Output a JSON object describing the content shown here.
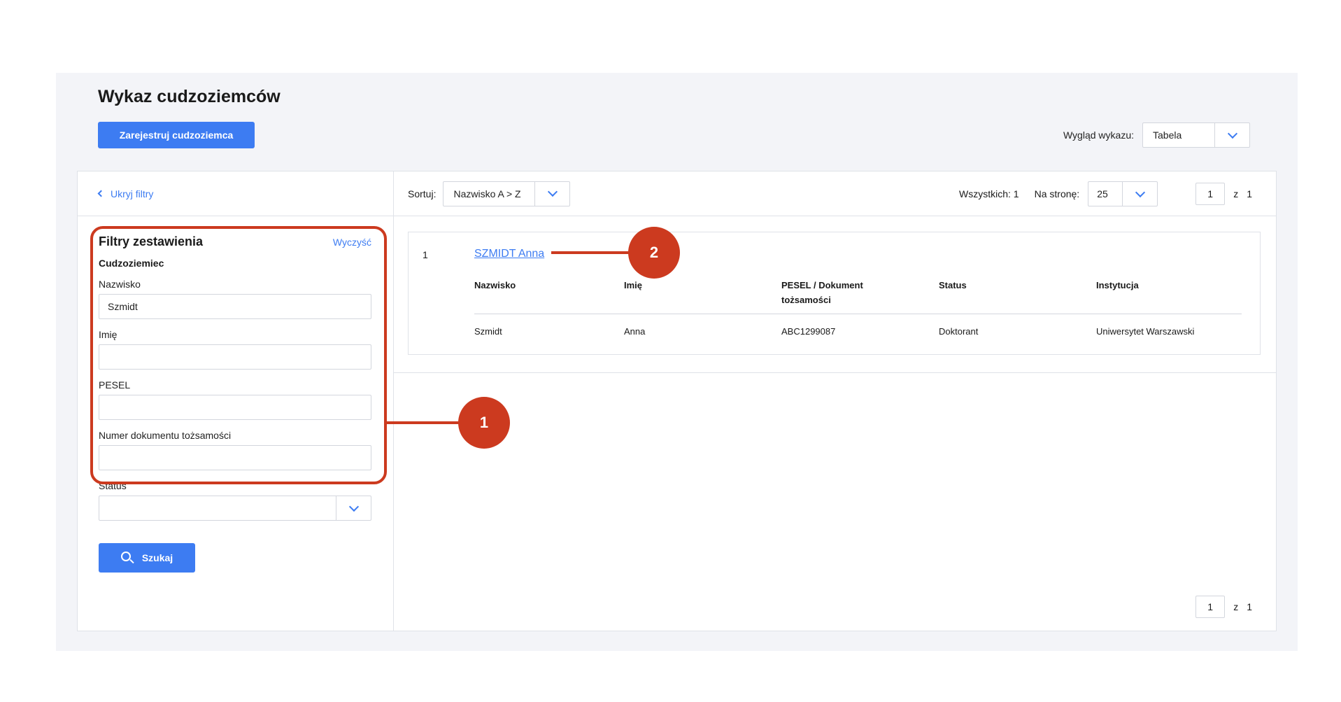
{
  "page": {
    "title": "Wykaz cudzoziemców",
    "register_button": "Zarejestruj cudzoziemca",
    "view_label": "Wygląd wykazu:",
    "view_value": "Tabela"
  },
  "filters": {
    "hide_label": "Ukryj filtry",
    "title": "Filtry zestawienia",
    "clear_label": "Wyczyść",
    "section": "Cudzoziemiec",
    "fields": {
      "surname_label": "Nazwisko",
      "surname_value": "Szmidt",
      "name_label": "Imię",
      "name_value": "",
      "pesel_label": "PESEL",
      "pesel_value": "",
      "doc_label": "Numer dokumentu tożsamości",
      "doc_value": "",
      "status_label": "Status",
      "status_value": ""
    },
    "search_button": "Szukaj"
  },
  "toolbar": {
    "sort_label": "Sortuj:",
    "sort_value": "Nazwisko A > Z",
    "total_label": "Wszystkich: 1",
    "per_page_label": "Na stronę:",
    "per_page_value": "25",
    "page_current": "1",
    "page_of": "z",
    "page_total": "1"
  },
  "results": {
    "index": "1",
    "name_link": "SZMIDT Anna",
    "headers": [
      "Nazwisko",
      "Imię",
      "PESEL / Dokument tożsamości",
      "Status",
      "Instytucja"
    ],
    "values": [
      "Szmidt",
      "Anna",
      "ABC1299087",
      "Doktorant",
      "Uniwersytet Warszawski"
    ]
  },
  "annotations": {
    "marker_1": "1",
    "marker_2": "2",
    "color": "#cc3a1f"
  },
  "colors": {
    "accent": "#3d7cf2",
    "background": "#f3f4f8"
  }
}
